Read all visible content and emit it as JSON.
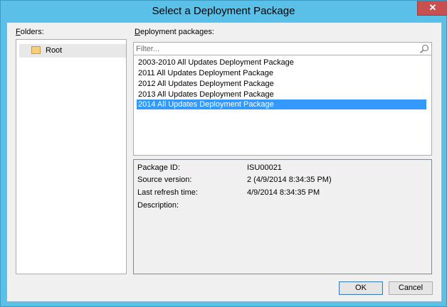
{
  "window": {
    "title": "Select a Deployment Package",
    "close_symbol": "✕"
  },
  "folders": {
    "label": "Folders:",
    "items": [
      {
        "label": "Root",
        "icon": "folder-icon"
      }
    ]
  },
  "packages": {
    "label": "Deployment packages:",
    "filter_placeholder": "Filter...",
    "items": [
      {
        "label": "2003-2010 All Updates Deployment Package",
        "selected": false
      },
      {
        "label": "2011 All Updates Deployment Package",
        "selected": false
      },
      {
        "label": "2012 All Updates Deployment Package",
        "selected": false
      },
      {
        "label": "2013 All Updates Deployment Package",
        "selected": false
      },
      {
        "label": "2014 All Updates Deployment Package",
        "selected": true
      }
    ]
  },
  "details": {
    "package_id_label": "Package ID:",
    "package_id_value": "ISU00021",
    "source_version_label": "Source version:",
    "source_version_value": "2 (4/9/2014 8:34:35 PM)",
    "last_refresh_label": "Last refresh time:",
    "last_refresh_value": "4/9/2014 8:34:35 PM",
    "description_label": "Description:"
  },
  "buttons": {
    "ok": "OK",
    "cancel": "Cancel"
  },
  "colors": {
    "title_bar": "#5bc0e8",
    "selection": "#3399ff",
    "close_button": "#c75050"
  }
}
